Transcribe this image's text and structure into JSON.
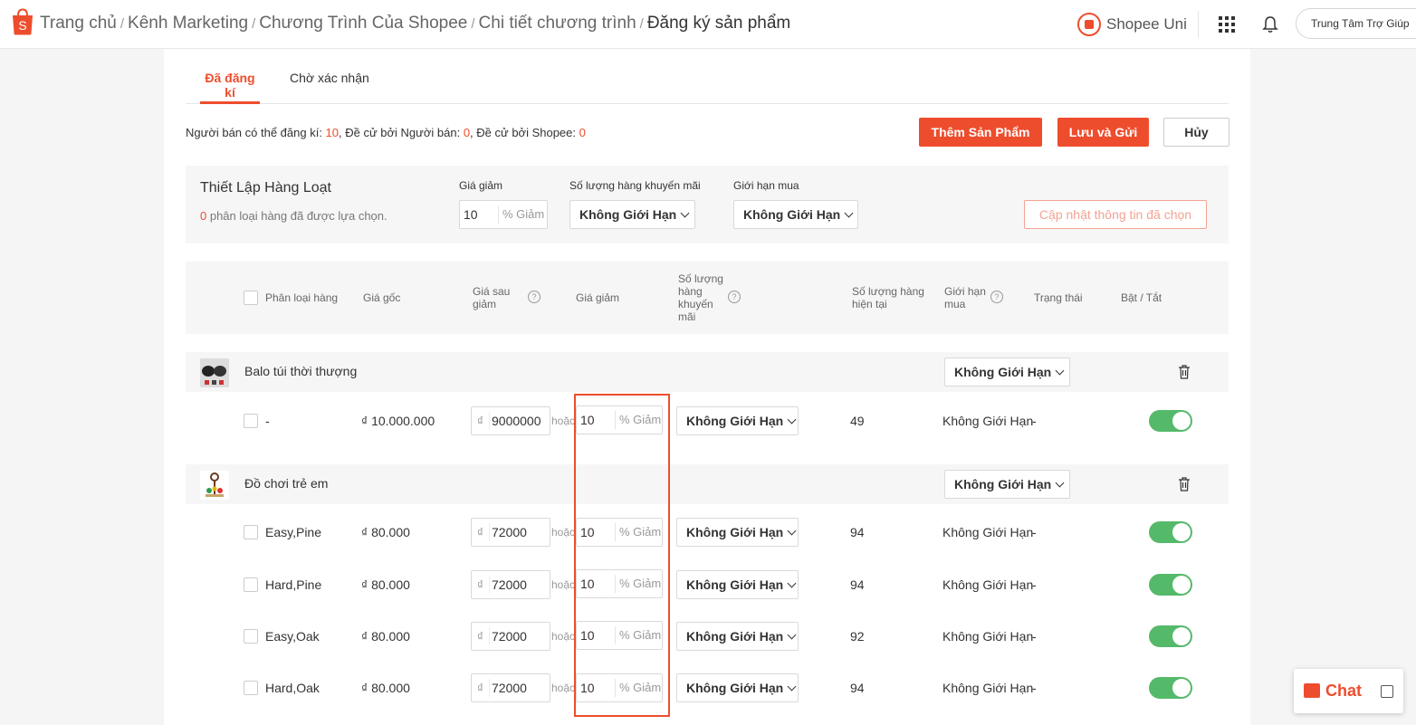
{
  "breadcrumb": [
    {
      "label": "Trang chủ"
    },
    {
      "label": "Kênh Marketing"
    },
    {
      "label": "Chương Trình Của Shopee"
    },
    {
      "label": "Chi tiết chương trình"
    },
    {
      "label": "Đăng ký sản phẩm"
    }
  ],
  "breadcrumb_sep": "/",
  "header": {
    "uni_label": "Shopee Uni",
    "help_label": "Trung Tâm Trợ Giúp"
  },
  "tabs": [
    {
      "label": "Đã đăng kí",
      "active": true
    },
    {
      "label": "Chờ xác nhận",
      "active": false
    }
  ],
  "quota": {
    "p1": "Người bán có thể đăng kí: ",
    "v1": "10",
    "p2": ", Đề cử bởi Người bán: ",
    "v2": "0",
    "p3": ", Đề cử bởi Shopee: ",
    "v3": "0"
  },
  "actions": {
    "add": "Thêm Sản Phẩm",
    "save": "Lưu và Gửi",
    "cancel": "Hủy"
  },
  "bulk": {
    "title": "Thiết Lập Hàng Loạt",
    "count": "0",
    "sub": " phân loại hàng đã được lựa chọn.",
    "discount_label": "Giá giảm",
    "discount_value": "10",
    "discount_suffix": "% Giảm",
    "qty_label": "Số lượng hàng khuyến mãi",
    "qty_value": "Không Giới Hạn",
    "limit_label": "Giới hạn mua",
    "limit_value": "Không Giới Hạn",
    "update_label": "Cập nhật thông tin đã chọn"
  },
  "columns": {
    "variant": "Phân loại hàng",
    "orig_price": "Giá gốc",
    "after_price": "Giá sau giảm",
    "discount": "Giá giảm",
    "promo_qty": "Số lượng hàng khuyến mãi",
    "stock": "Số lượng hàng hiện tại",
    "limit": "Giới hạn mua",
    "status": "Trạng thái",
    "toggle": "Bật / Tắt"
  },
  "or_label": "hoặc",
  "currency": "₫",
  "groups": [
    {
      "name": "Balo túi thời thượng",
      "limit": "Không Giới Hạn",
      "rows": [
        {
          "variant": "-",
          "orig": "₫ 10.000.000",
          "after": "9000000",
          "pct": "10",
          "pct_suffix": "% Giảm",
          "qty": "Không Giới Hạn",
          "stock": "49",
          "limit": "Không Giới Hạn",
          "status": "-",
          "on": true
        }
      ]
    },
    {
      "name": "Đồ chơi trẻ em",
      "limit": "Không Giới Hạn",
      "rows": [
        {
          "variant": "Easy,Pine",
          "orig": "₫ 80.000",
          "after": "72000",
          "pct": "10",
          "pct_suffix": "% Giảm",
          "qty": "Không Giới Hạn",
          "stock": "94",
          "limit": "Không Giới Hạn",
          "status": "-",
          "on": true
        },
        {
          "variant": "Hard,Pine",
          "orig": "₫ 80.000",
          "after": "72000",
          "pct": "10",
          "pct_suffix": "% Giảm",
          "qty": "Không Giới Hạn",
          "stock": "94",
          "limit": "Không Giới Hạn",
          "status": "-",
          "on": true
        },
        {
          "variant": "Easy,Oak",
          "orig": "₫ 80.000",
          "after": "72000",
          "pct": "10",
          "pct_suffix": "% Giảm",
          "qty": "Không Giới Hạn",
          "stock": "92",
          "limit": "Không Giới Hạn",
          "status": "-",
          "on": true
        },
        {
          "variant": "Hard,Oak",
          "orig": "₫ 80.000",
          "after": "72000",
          "pct": "10",
          "pct_suffix": "% Giảm",
          "qty": "Không Giới Hạn",
          "stock": "94",
          "limit": "Không Giới Hạn",
          "status": "-",
          "on": true
        }
      ]
    }
  ],
  "chat": {
    "label": "Chat"
  },
  "colors": {
    "brand": "#ee4d2d",
    "toggle_on": "#55b96a"
  }
}
